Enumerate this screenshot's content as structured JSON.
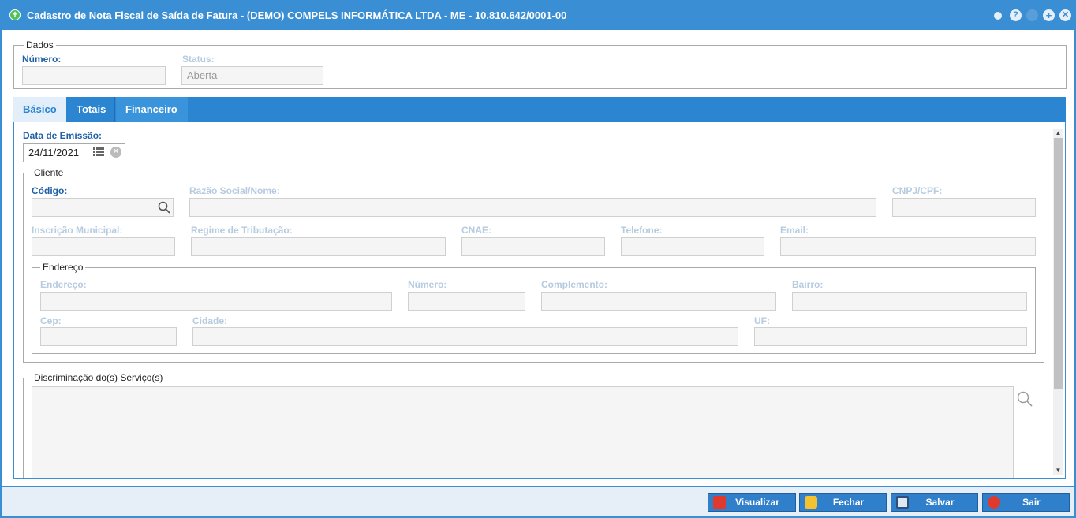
{
  "window": {
    "title": "Cadastro de Nota Fiscal de Saída de Fatura - (DEMO) COMPELS INFORMÁTICA LTDA - ME - 10.810.642/0001-00",
    "help_label": "?"
  },
  "dados": {
    "legend": "Dados",
    "numero_label": "Número:",
    "numero_value": "",
    "status_label": "Status:",
    "status_value": "Aberta"
  },
  "tabs": [
    {
      "label": "Básico",
      "active": true
    },
    {
      "label": "Totais",
      "active": false
    },
    {
      "label": "Financeiro",
      "active": false
    }
  ],
  "basico": {
    "data_emissao_label": "Data de Emissão:",
    "data_emissao_value": "24/11/2021",
    "cliente": {
      "legend": "Cliente",
      "codigo_label": "Código:",
      "razao_label": "Razão Social/Nome:",
      "cnpj_label": "CNPJ/CPF:",
      "insc_label": "Inscrição Municipal:",
      "regime_label": "Regime de Tributação:",
      "cnae_label": "CNAE:",
      "telefone_label": "Telefone:",
      "email_label": "Email:"
    },
    "endereco": {
      "legend": "Endereço",
      "endereco_label": "Endereço:",
      "numero_label": "Número:",
      "complemento_label": "Complemento:",
      "bairro_label": "Bairro:",
      "cep_label": "Cep:",
      "cidade_label": "Cidade:",
      "uf_label": "UF:"
    },
    "servicos": {
      "legend": "Discriminação do(s) Serviço(s)"
    }
  },
  "footer": {
    "visualizar": "Visualizar",
    "fechar": "Fechar",
    "salvar": "Salvar",
    "sair": "Sair"
  },
  "colors": {
    "accent": "#3a8fd4",
    "tab_bar": "#2b85d0",
    "label_active": "#1f5fa6",
    "label_disabled": "#b6cbe0"
  }
}
